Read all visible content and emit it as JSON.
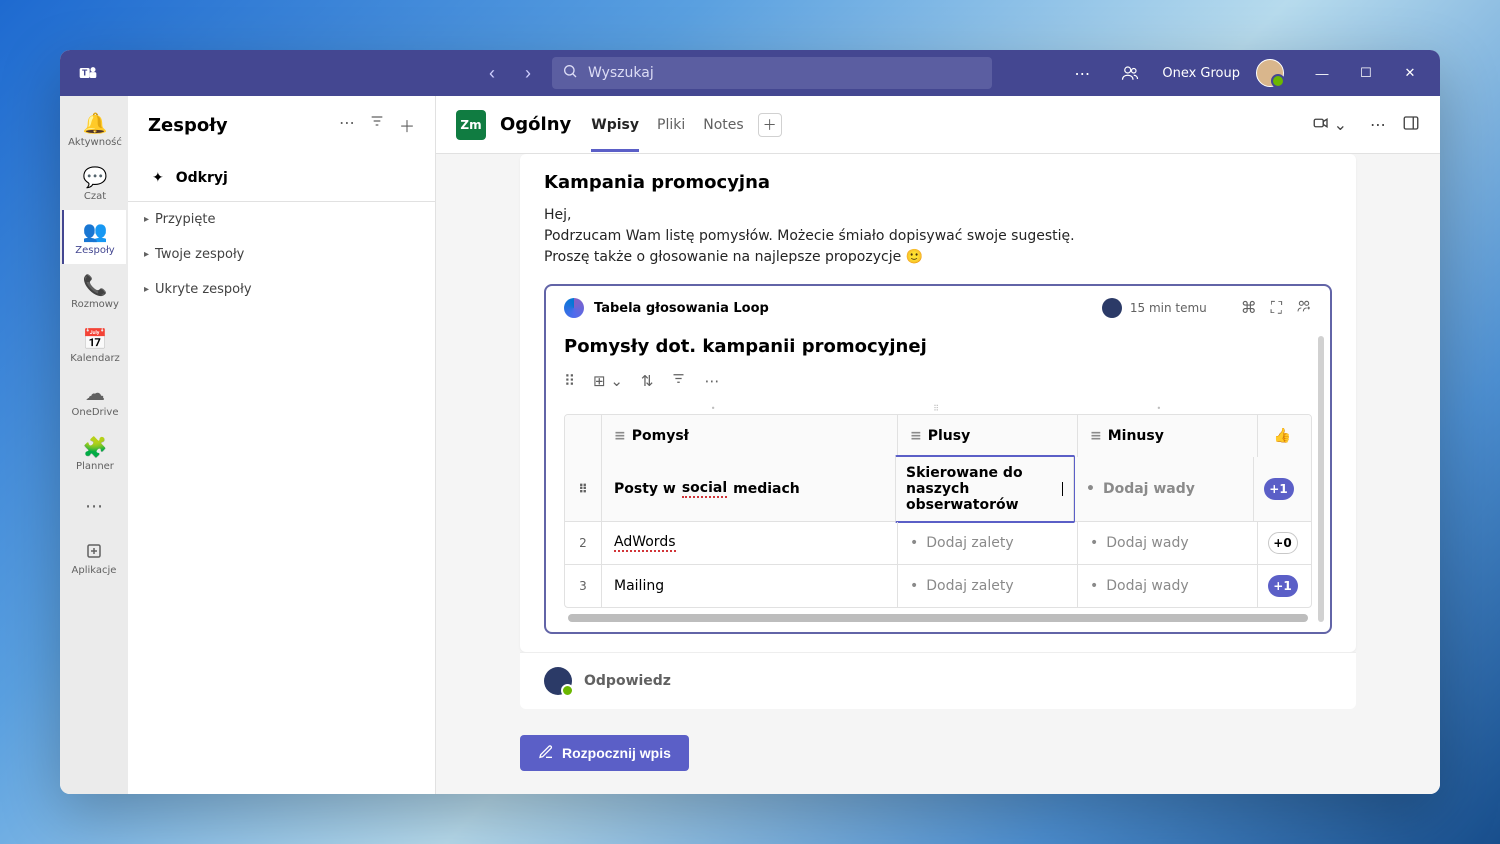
{
  "titlebar": {
    "search_placeholder": "Wyszukaj",
    "org_name": "Onex Group"
  },
  "apprail": {
    "items": [
      {
        "label": "Aktywność",
        "icon": "🔔"
      },
      {
        "label": "Czat",
        "icon": "💬"
      },
      {
        "label": "Zespoły",
        "icon": "👥"
      },
      {
        "label": "Rozmowy",
        "icon": "📞"
      },
      {
        "label": "Kalendarz",
        "icon": "📅"
      },
      {
        "label": "OneDrive",
        "icon": "☁"
      },
      {
        "label": "Planner",
        "icon": "🧩"
      }
    ],
    "apps_label": "Aplikacje"
  },
  "sidebar": {
    "title": "Zespoły",
    "discover": "Odkryj",
    "sections": [
      "Przypięte",
      "Twoje zespoły",
      "Ukryte zespoły"
    ]
  },
  "channel": {
    "team_initials": "Zm",
    "name": "Ogólny",
    "tabs": [
      "Wpisy",
      "Pliki",
      "Notes"
    ]
  },
  "post": {
    "title": "Kampania promocyjna",
    "line1": "Hej,",
    "line2": "Podrzucam Wam listę pomysłów. Możecie śmiało dopisywać swoje sugestię.",
    "line3": "Proszę także o głosowanie na najlepsze propozycje 🙂"
  },
  "loop": {
    "type_label": "Tabela głosowania Loop",
    "time": "15 min temu",
    "heading": "Pomysły dot. kampanii promocyjnej",
    "columns": {
      "idea": "Pomysł",
      "plus": "Plusy",
      "minus": "Minusy"
    },
    "rows": [
      {
        "num": "",
        "idea_pre": "Posty w ",
        "idea_u": "social",
        "idea_post": " mediach",
        "plus": "Skierowane do naszych obserwatorów",
        "minus": "Dodaj wady",
        "vote": "+1",
        "votestyle": "blue",
        "editing": true,
        "minus_placeholder": true
      },
      {
        "num": "2",
        "idea_pre": "",
        "idea_u": "AdWords",
        "idea_post": "",
        "plus": "Dodaj zalety",
        "minus": "Dodaj wady",
        "vote": "+0",
        "votestyle": "outline",
        "plus_placeholder": true,
        "minus_placeholder": true
      },
      {
        "num": "3",
        "idea_pre": "Mailing",
        "idea_u": "",
        "idea_post": "",
        "plus": "Dodaj zalety",
        "minus": "Dodaj wady",
        "vote": "+1",
        "votestyle": "blue",
        "plus_placeholder": true,
        "minus_placeholder": true
      }
    ]
  },
  "reply_label": "Odpowiedz",
  "newpost_label": "Rozpocznij wpis"
}
